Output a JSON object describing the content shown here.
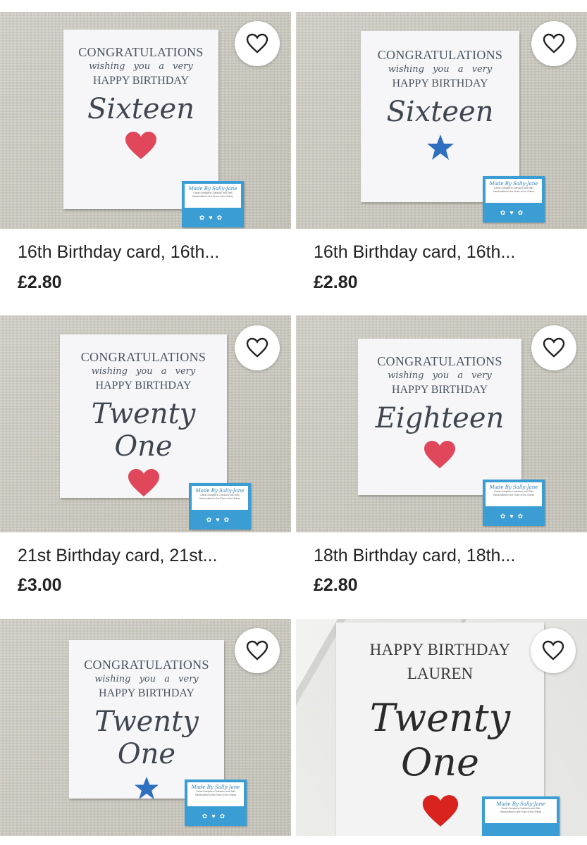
{
  "listings": [
    {
      "title": "16th Birthday card, 16th...",
      "price": "£2.80",
      "card": {
        "line1": "CONGRATULATIONS",
        "line2": "wishing you a very",
        "line3": "HAPPY BIRTHDAY",
        "big": "Sixteen",
        "symbol": "heart"
      },
      "label": {
        "brand": "Made By Sally-Jane",
        "sub1": "Cards Sumpters Cushions and Gifts",
        "sub2": "Handcrafted in the Rose of the Shires"
      }
    },
    {
      "title": "16th Birthday card, 16th...",
      "price": "£2.80",
      "card": {
        "line1": "CONGRATULATIONS",
        "line2": "wishing you a very",
        "line3": "HAPPY BIRTHDAY",
        "big": "Sixteen",
        "symbol": "star"
      },
      "label": {
        "brand": "Made By Sally-Jane",
        "sub1": "Cards Sumpters Cushions and Gifts",
        "sub2": "Handcrafted in the Rose of the Shires"
      }
    },
    {
      "title": "21st Birthday card, 21st...",
      "price": "£3.00",
      "card": {
        "line1": "CONGRATULATIONS",
        "line2": "wishing you a very",
        "line3": "HAPPY BIRTHDAY",
        "big": "Twenty One",
        "symbol": "heart"
      },
      "label": {
        "brand": "Made By Sally-Jane",
        "sub1": "Cards Sumpters Cushions and Gifts",
        "sub2": "Handcrafted in the Rose of the Shires"
      }
    },
    {
      "title": "18th Birthday card, 18th...",
      "price": "£2.80",
      "card": {
        "line1": "CONGRATULATIONS",
        "line2": "wishing you a very",
        "line3": "HAPPY BIRTHDAY",
        "big": "Eighteen",
        "symbol": "heart"
      },
      "label": {
        "brand": "Made By Sally-Jane",
        "sub1": "Cards Sumpters Cushions and Gifts",
        "sub2": "Handcrafted in the Rose of the Shires"
      }
    },
    {
      "card": {
        "line1": "CONGRATULATIONS",
        "line2": "wishing you a very",
        "line3": "HAPPY BIRTHDAY",
        "big": "Twenty One",
        "symbol": "star"
      },
      "label": {
        "brand": "Made By Sally-Jane",
        "sub1": "Cards Sumpters Cushions and Gifts",
        "sub2": "Handcrafted in the Rose of the Shires"
      }
    },
    {
      "card": {
        "line1": "HAPPY BIRTHDAY",
        "line3": "LAUREN",
        "big": "Twenty One",
        "symbol": "heart"
      },
      "label": {
        "brand": "Made By Sally-Jane",
        "sub1": "Cards Sumpters Cushions and Gifts",
        "sub2": "Handcrafted in the Rose of the Shires"
      }
    }
  ],
  "colors": {
    "heart": "#e0475b",
    "heart_red": "#d8231f",
    "star": "#2f6fbf",
    "label_blue": "#3a9dd3"
  },
  "icons": {
    "favorite": "heart-outline-icon"
  }
}
